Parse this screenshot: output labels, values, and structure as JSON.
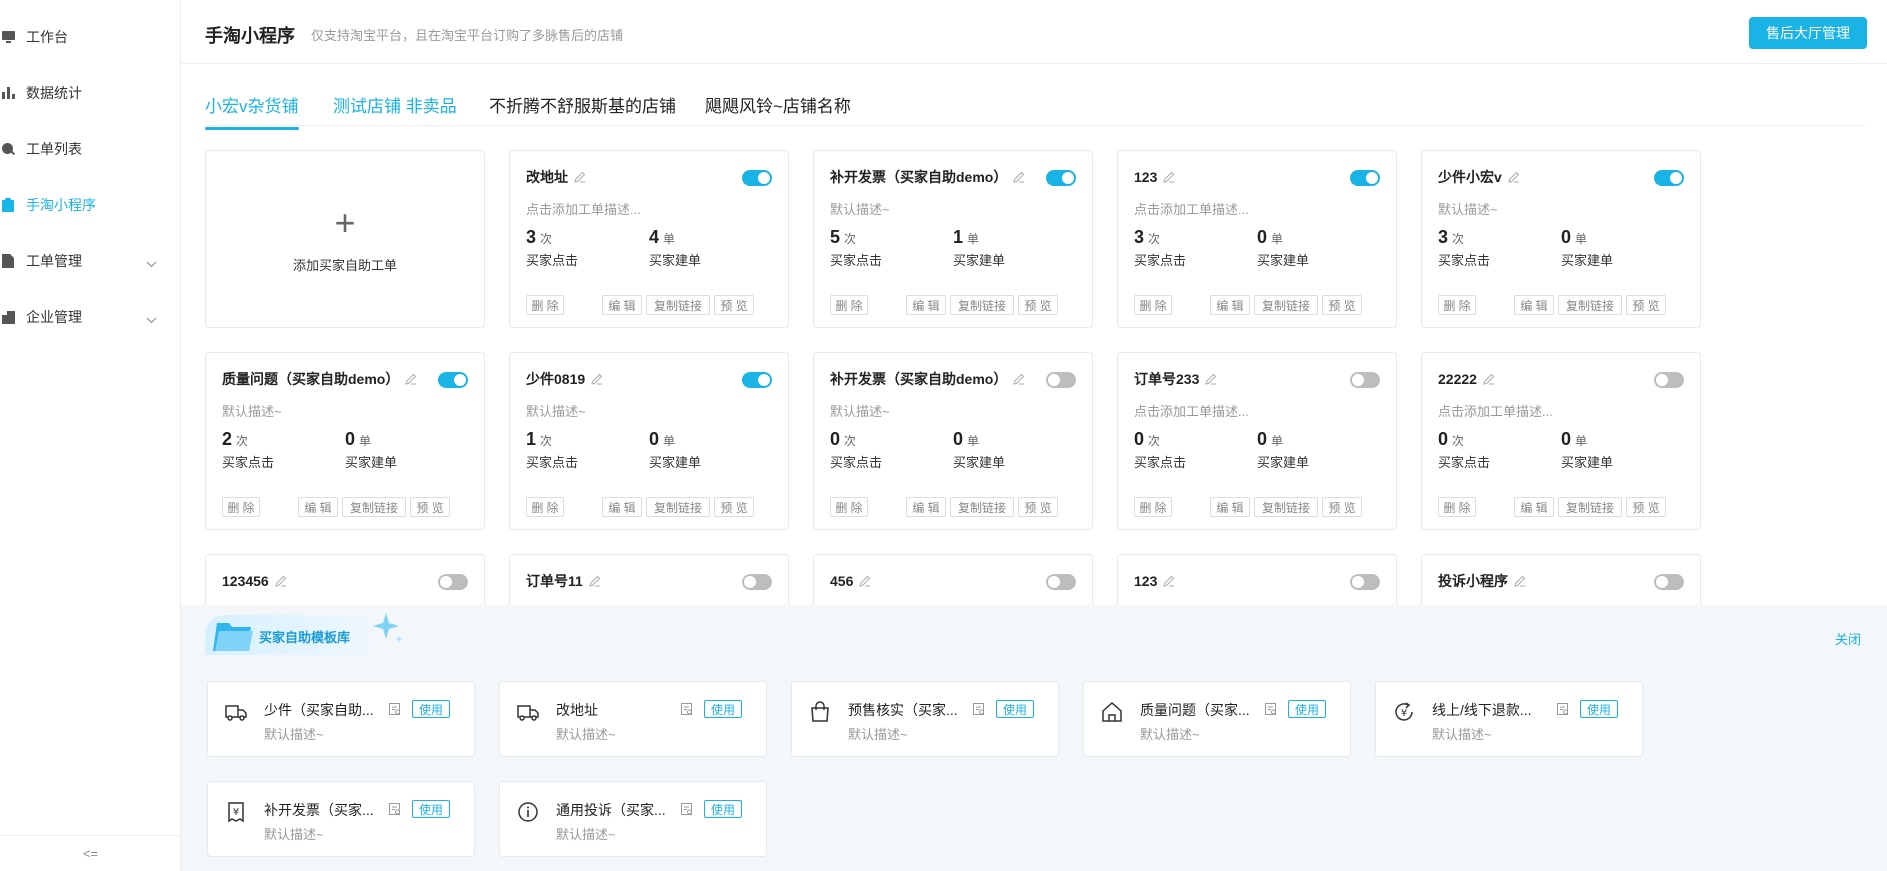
{
  "sidebar": {
    "items": [
      {
        "label": "工作台",
        "icon": "monitor-icon"
      },
      {
        "label": "数据统计",
        "icon": "bar-chart-icon"
      },
      {
        "label": "工单列表",
        "icon": "search-icon"
      },
      {
        "label": "手淘小程序",
        "icon": "clipboard-icon",
        "active": true
      },
      {
        "label": "工单管理",
        "icon": "document-icon",
        "expandable": true
      },
      {
        "label": "企业管理",
        "icon": "building-icon",
        "expandable": true
      }
    ],
    "collapse_label": "<="
  },
  "header": {
    "title": "手淘小程序",
    "subtitle": "仅支持淘宝平台，且在淘宝平台订购了多脉售后的店铺",
    "button_label": "售后大厅管理"
  },
  "tabs": [
    {
      "label": "小宏v杂货铺",
      "active": true
    },
    {
      "label": "测试店铺 非卖品"
    },
    {
      "label": "不折腾不舒服斯基的店铺"
    },
    {
      "label": "飓飓风铃~店铺名称"
    }
  ],
  "add_card": {
    "label": "添加买家自助工单"
  },
  "card_labels": {
    "clicks_unit": "次",
    "orders_unit": "单",
    "clicks_label": "买家点击",
    "orders_label": "买家建单",
    "delete": "删 除",
    "edit": "编 辑",
    "copy": "复制链接",
    "preview": "预 览"
  },
  "cards": [
    {
      "title": "改地址",
      "desc": "点击添加工单描述...",
      "clicks": "3",
      "orders": "4",
      "enabled": true
    },
    {
      "title": "补开发票（买家自助demo）",
      "desc": "默认描述~",
      "clicks": "5",
      "orders": "1",
      "enabled": true
    },
    {
      "title": "123",
      "desc": "点击添加工单描述...",
      "clicks": "3",
      "orders": "0",
      "enabled": true
    },
    {
      "title": "少件小宏v",
      "desc": "默认描述~",
      "clicks": "3",
      "orders": "0",
      "enabled": true
    },
    {
      "title": "质量问题（买家自助demo）",
      "desc": "默认描述~",
      "clicks": "2",
      "orders": "0",
      "enabled": true
    },
    {
      "title": "少件0819",
      "desc": "默认描述~",
      "clicks": "1",
      "orders": "0",
      "enabled": true
    },
    {
      "title": "补开发票（买家自助demo）",
      "desc": "默认描述~",
      "clicks": "0",
      "orders": "0",
      "enabled": false
    },
    {
      "title": "订单号233",
      "desc": "点击添加工单描述...",
      "clicks": "0",
      "orders": "0",
      "enabled": false
    },
    {
      "title": "22222",
      "desc": "点击添加工单描述...",
      "clicks": "0",
      "orders": "0",
      "enabled": false
    },
    {
      "title": "123456",
      "desc": "",
      "clicks": "",
      "orders": "",
      "enabled": false
    },
    {
      "title": "订单号11",
      "desc": "",
      "clicks": "",
      "orders": "",
      "enabled": false
    },
    {
      "title": "456",
      "desc": "",
      "clicks": "",
      "orders": "",
      "enabled": false
    },
    {
      "title": "123",
      "desc": "",
      "clicks": "",
      "orders": "",
      "enabled": false
    },
    {
      "title": "投诉小程序",
      "desc": "",
      "clicks": "",
      "orders": "",
      "enabled": false
    }
  ],
  "templates": {
    "title": "买家自助模板库",
    "close_label": "关闭",
    "use_label": "使用",
    "items": [
      {
        "name": "少件（买家自助...",
        "desc": "默认描述~",
        "icon": "truck-icon"
      },
      {
        "name": "改地址",
        "desc": "默认描述~",
        "icon": "truck-icon"
      },
      {
        "name": "预售核实（买家...",
        "desc": "默认描述~",
        "icon": "shopping-bag-icon"
      },
      {
        "name": "质量问题（买家...",
        "desc": "默认描述~",
        "icon": "home-icon"
      },
      {
        "name": "线上/线下退款...",
        "desc": "默认描述~",
        "icon": "refund-yen-icon"
      },
      {
        "name": "补开发票（买家...",
        "desc": "默认描述~",
        "icon": "invoice-yen-icon"
      },
      {
        "name": "通用投诉（买家...",
        "desc": "默认描述~",
        "icon": "info-icon"
      }
    ]
  },
  "colors": {
    "accent": "#1ab3e6",
    "toggle_off": "#bdbdbd"
  }
}
